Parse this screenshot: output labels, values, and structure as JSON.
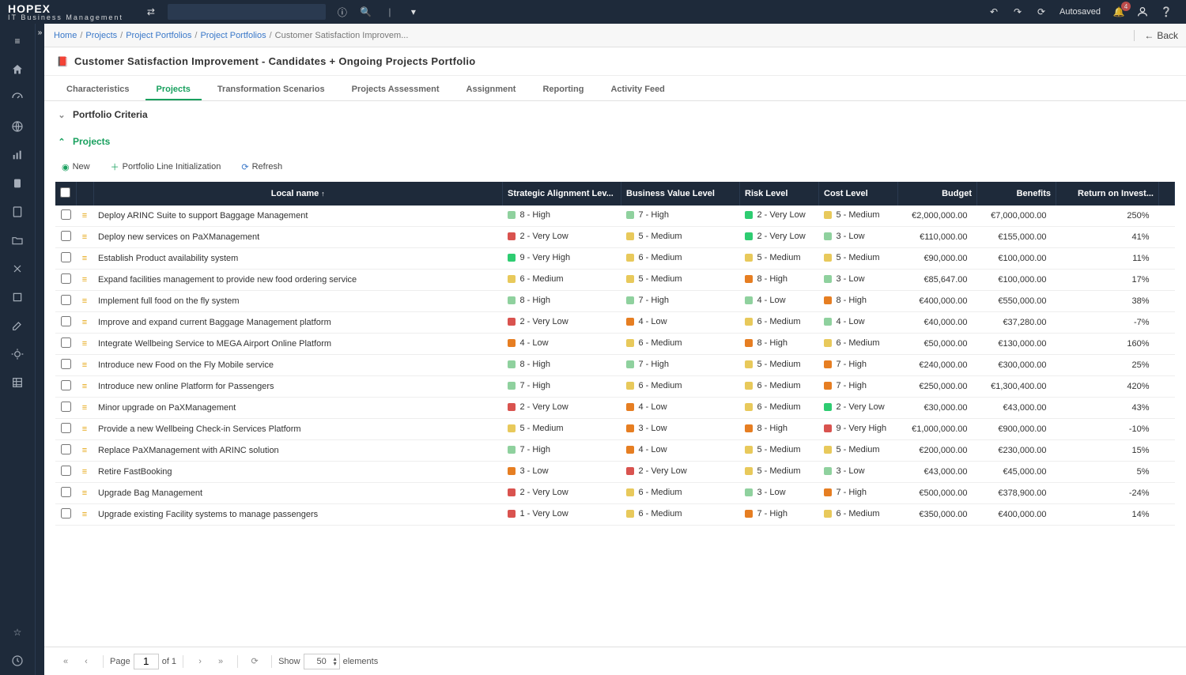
{
  "brand": {
    "main": "HOPEX",
    "sub": "IT Business Management"
  },
  "topbar": {
    "autosaved": "Autosaved",
    "notif_count": "4"
  },
  "breadcrumbs": {
    "items": [
      "Home",
      "Projects",
      "Project Portfolios",
      "Project Portfolios",
      "Customer Satisfaction Improvem..."
    ],
    "back_label": "Back"
  },
  "page": {
    "title": "Customer Satisfaction Improvement - Candidates + Ongoing Projects Portfolio"
  },
  "tabs": [
    "Characteristics",
    "Projects",
    "Transformation Scenarios",
    "Projects Assessment",
    "Assignment",
    "Reporting",
    "Activity Feed"
  ],
  "active_tab_index": 1,
  "sections": {
    "portfolio_criteria": "Portfolio Criteria",
    "projects": "Projects"
  },
  "toolbar": {
    "new": "New",
    "init": "Portfolio Line Initialization",
    "refresh": "Refresh"
  },
  "columns": [
    "",
    "",
    "Local name",
    "Strategic Alignment Lev...",
    "Business Value Level",
    "Risk Level",
    "Cost Level",
    "Budget",
    "Benefits",
    "Return on Invest...",
    ""
  ],
  "rows": [
    {
      "name": "Deploy ARINC Suite to support Baggage Management",
      "sa": {
        "n": 8,
        "t": "8 - High"
      },
      "bv": {
        "n": 7,
        "t": "7 - High"
      },
      "risk": {
        "n": 2,
        "t": "2 - Very Low"
      },
      "cost": {
        "n": 5,
        "t": "5 - Medium"
      },
      "budget": "€2,000,000.00",
      "benefits": "€7,000,000.00",
      "roi": "250%"
    },
    {
      "name": "Deploy new services on PaXManagement",
      "sa": {
        "n": 2,
        "t": "2 - Very Low"
      },
      "bv": {
        "n": 5,
        "t": "5 - Medium"
      },
      "risk": {
        "n": 2,
        "t": "2 - Very Low"
      },
      "cost": {
        "n": 3,
        "t": "3 - Low"
      },
      "budget": "€110,000.00",
      "benefits": "€155,000.00",
      "roi": "41%"
    },
    {
      "name": "Establish Product availability system",
      "sa": {
        "n": 9,
        "t": "9 - Very High"
      },
      "bv": {
        "n": 6,
        "t": "6 - Medium"
      },
      "risk": {
        "n": 5,
        "t": "5 - Medium"
      },
      "cost": {
        "n": 5,
        "t": "5 - Medium"
      },
      "budget": "€90,000.00",
      "benefits": "€100,000.00",
      "roi": "11%"
    },
    {
      "name": "Expand facilities management to provide new food ordering service",
      "sa": {
        "n": 6,
        "t": "6 - Medium"
      },
      "bv": {
        "n": 5,
        "t": "5 - Medium"
      },
      "risk": {
        "n": 8,
        "t": "8 - High"
      },
      "cost": {
        "n": 3,
        "t": "3 - Low"
      },
      "budget": "€85,647.00",
      "benefits": "€100,000.00",
      "roi": "17%"
    },
    {
      "name": "Implement full food on the fly system",
      "sa": {
        "n": 8,
        "t": "8 - High"
      },
      "bv": {
        "n": 7,
        "t": "7 - High"
      },
      "risk": {
        "n": 4,
        "t": "4 - Low"
      },
      "cost": {
        "n": 8,
        "t": "8 - High"
      },
      "budget": "€400,000.00",
      "benefits": "€550,000.00",
      "roi": "38%"
    },
    {
      "name": "Improve and expand current Baggage Management platform",
      "sa": {
        "n": 2,
        "t": "2 - Very Low"
      },
      "bv": {
        "n": 4,
        "t": "4 - Low"
      },
      "risk": {
        "n": 6,
        "t": "6 - Medium"
      },
      "cost": {
        "n": 4,
        "t": "4 - Low"
      },
      "budget": "€40,000.00",
      "benefits": "€37,280.00",
      "roi": "-7%"
    },
    {
      "name": "Integrate Wellbeing Service to MEGA Airport Online Platform",
      "sa": {
        "n": 4,
        "t": "4 - Low"
      },
      "bv": {
        "n": 6,
        "t": "6 - Medium"
      },
      "risk": {
        "n": 8,
        "t": "8 - High"
      },
      "cost": {
        "n": 6,
        "t": "6 - Medium"
      },
      "budget": "€50,000.00",
      "benefits": "€130,000.00",
      "roi": "160%"
    },
    {
      "name": "Introduce new Food on the Fly Mobile service",
      "sa": {
        "n": 8,
        "t": "8 - High"
      },
      "bv": {
        "n": 7,
        "t": "7 - High"
      },
      "risk": {
        "n": 5,
        "t": "5 - Medium"
      },
      "cost": {
        "n": 7,
        "t": "7 - High"
      },
      "budget": "€240,000.00",
      "benefits": "€300,000.00",
      "roi": "25%"
    },
    {
      "name": "Introduce new online Platform for Passengers",
      "sa": {
        "n": 7,
        "t": "7 - High"
      },
      "bv": {
        "n": 6,
        "t": "6 - Medium"
      },
      "risk": {
        "n": 6,
        "t": "6 - Medium"
      },
      "cost": {
        "n": 7,
        "t": "7 - High"
      },
      "budget": "€250,000.00",
      "benefits": "€1,300,400.00",
      "roi": "420%"
    },
    {
      "name": "Minor upgrade on PaXManagement",
      "sa": {
        "n": 2,
        "t": "2 - Very Low"
      },
      "bv": {
        "n": 4,
        "t": "4 - Low"
      },
      "risk": {
        "n": 6,
        "t": "6 - Medium"
      },
      "cost": {
        "n": 2,
        "t": "2 - Very Low"
      },
      "budget": "€30,000.00",
      "benefits": "€43,000.00",
      "roi": "43%"
    },
    {
      "name": "Provide a new Wellbeing Check-in Services Platform",
      "sa": {
        "n": 5,
        "t": "5 - Medium"
      },
      "bv": {
        "n": 3,
        "t": "3 - Low"
      },
      "risk": {
        "n": 8,
        "t": "8 - High"
      },
      "cost": {
        "n": 9,
        "t": "9 - Very High"
      },
      "budget": "€1,000,000.00",
      "benefits": "€900,000.00",
      "roi": "-10%"
    },
    {
      "name": "Replace PaXManagement with ARINC solution",
      "sa": {
        "n": 7,
        "t": "7 - High"
      },
      "bv": {
        "n": 4,
        "t": "4 - Low"
      },
      "risk": {
        "n": 5,
        "t": "5 - Medium"
      },
      "cost": {
        "n": 5,
        "t": "5 - Medium"
      },
      "budget": "€200,000.00",
      "benefits": "€230,000.00",
      "roi": "15%"
    },
    {
      "name": "Retire FastBooking",
      "sa": {
        "n": 3,
        "t": "3 - Low"
      },
      "bv": {
        "n": 2,
        "t": "2 - Very Low"
      },
      "risk": {
        "n": 5,
        "t": "5 - Medium"
      },
      "cost": {
        "n": 3,
        "t": "3 - Low"
      },
      "budget": "€43,000.00",
      "benefits": "€45,000.00",
      "roi": "5%"
    },
    {
      "name": "Upgrade Bag Management",
      "sa": {
        "n": 2,
        "t": "2 - Very Low"
      },
      "bv": {
        "n": 6,
        "t": "6 - Medium"
      },
      "risk": {
        "n": 3,
        "t": "3 - Low"
      },
      "cost": {
        "n": 7,
        "t": "7 - High"
      },
      "budget": "€500,000.00",
      "benefits": "€378,900.00",
      "roi": "-24%"
    },
    {
      "name": "Upgrade existing Facility systems to manage passengers",
      "sa": {
        "n": 1,
        "t": "1 - Very Low"
      },
      "bv": {
        "n": 6,
        "t": "6 - Medium"
      },
      "risk": {
        "n": 7,
        "t": "7 - High"
      },
      "cost": {
        "n": 6,
        "t": "6 - Medium"
      },
      "budget": "€350,000.00",
      "benefits": "€400,000.00",
      "roi": "14%"
    }
  ],
  "pager": {
    "page_label": "Page",
    "page": "1",
    "of": "of 1",
    "show_label": "Show",
    "size": "50",
    "elements": "elements"
  }
}
